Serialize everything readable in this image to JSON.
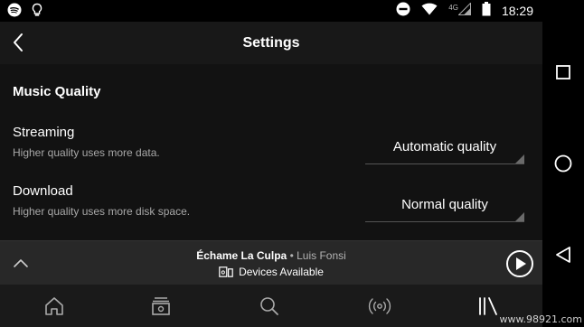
{
  "status_bar": {
    "time": "18:29",
    "network_label": "4G",
    "icons": [
      "spotify-icon",
      "lightbulb-icon",
      "do-not-disturb-icon",
      "wifi-icon",
      "cell-signal-icon",
      "battery-icon"
    ]
  },
  "header": {
    "title": "Settings",
    "back_icon": "back-arrow-icon"
  },
  "music_quality": {
    "section_title": "Music Quality",
    "streaming": {
      "title": "Streaming",
      "subtitle": "Higher quality uses more data.",
      "value": "Automatic quality"
    },
    "download": {
      "title": "Download",
      "subtitle": "Higher quality uses more disk space.",
      "value": "Normal quality"
    }
  },
  "now_playing": {
    "song": "Échame La Culpa",
    "separator": "•",
    "artist": "Luis Fonsi",
    "devices_label": "Devices Available"
  },
  "bottom_nav": {
    "items": [
      "home-icon",
      "browse-icon",
      "search-icon",
      "radio-icon",
      "library-icon"
    ]
  },
  "system_nav": [
    "recents-icon",
    "home-circle-icon",
    "back-triangle-icon"
  ],
  "watermark": "www.98921.com",
  "colors": {
    "background": "#121212",
    "header": "#181818",
    "now_playing_bar": "#282828",
    "subtitle_text": "#a8a8a8"
  }
}
